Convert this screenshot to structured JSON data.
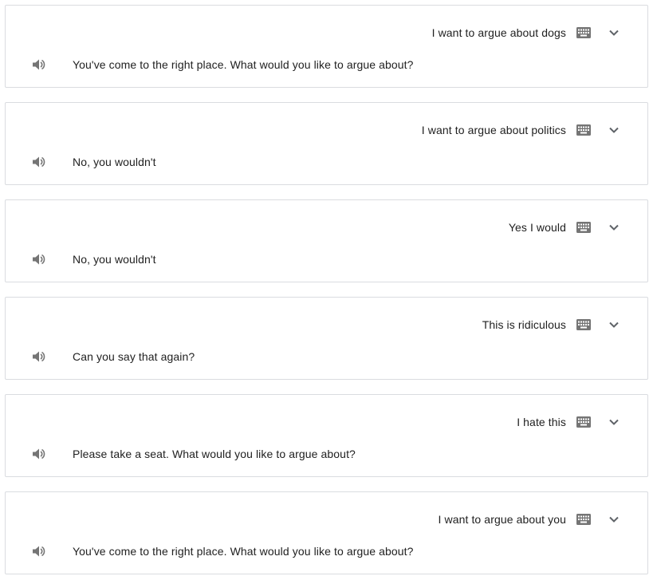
{
  "icons": {
    "keyboard": "keyboard-icon",
    "expand": "chevron-down-icon",
    "speaker": "volume-icon"
  },
  "colors": {
    "border": "#dadce0",
    "text": "#212121",
    "icon": "#757575"
  },
  "turns": [
    {
      "user": "I want to argue about dogs",
      "agent": "You've come to the right place. What would you like to argue about?"
    },
    {
      "user": "I want to argue about politics",
      "agent": "No, you wouldn't"
    },
    {
      "user": "Yes I would",
      "agent": "No, you wouldn't"
    },
    {
      "user": "This is ridiculous",
      "agent": "Can you say that again?"
    },
    {
      "user": "I hate this",
      "agent": "Please take a seat. What would you like to argue about?"
    },
    {
      "user": "I want to argue about you",
      "agent": "You've come to the right place. What would you like to argue about?"
    }
  ]
}
